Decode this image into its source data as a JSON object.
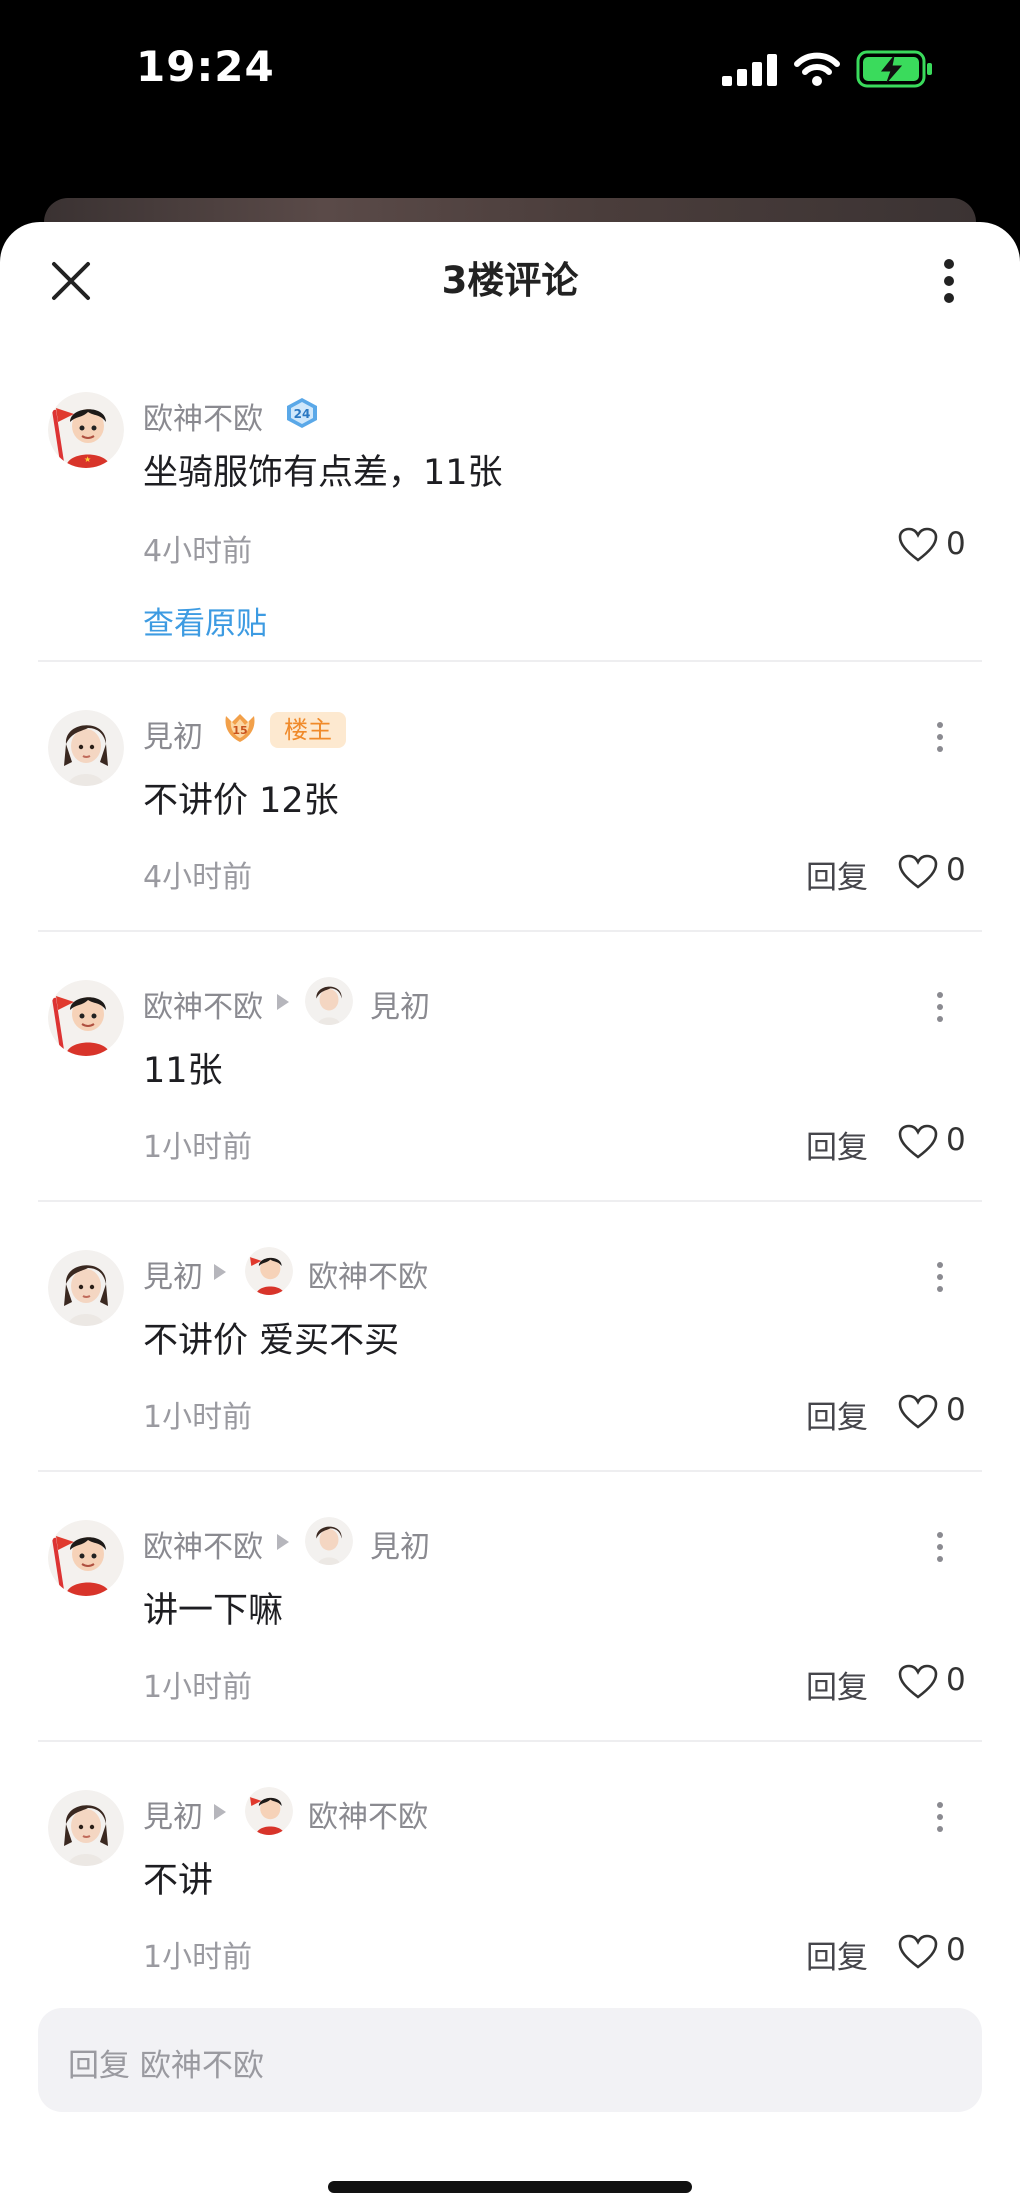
{
  "status": {
    "time": "19:24"
  },
  "header": {
    "title": "3楼评论"
  },
  "comments": [
    {
      "author": "欧神不欧",
      "level": "24",
      "text": "坐骑服饰有点差，11张",
      "time": "4小时前",
      "likes": "0",
      "link": "查看原贴"
    },
    {
      "author": "見初",
      "level": "15",
      "tag": "楼主",
      "text": "不讲价 12张",
      "time": "4小时前",
      "reply": "回复",
      "likes": "0"
    },
    {
      "author": "欧神不欧",
      "reply_to": "見初",
      "text": "11张",
      "time": "1小时前",
      "reply": "回复",
      "likes": "0"
    },
    {
      "author": "見初",
      "reply_to": "欧神不欧",
      "text": "不讲价 爱买不买",
      "time": "1小时前",
      "reply": "回复",
      "likes": "0"
    },
    {
      "author": "欧神不欧",
      "reply_to": "見初",
      "text": "讲一下嘛",
      "time": "1小时前",
      "reply": "回复",
      "likes": "0"
    },
    {
      "author": "見初",
      "reply_to": "欧神不欧",
      "text": "不讲",
      "time": "1小时前",
      "reply": "回复",
      "likes": "0"
    }
  ],
  "reply_bar": {
    "placeholder": "回复 欧神不欧"
  },
  "colors": {
    "link": "#3d9be2",
    "owner_tag_bg": "#fde9d0",
    "owner_tag_text": "#f08a2a"
  }
}
